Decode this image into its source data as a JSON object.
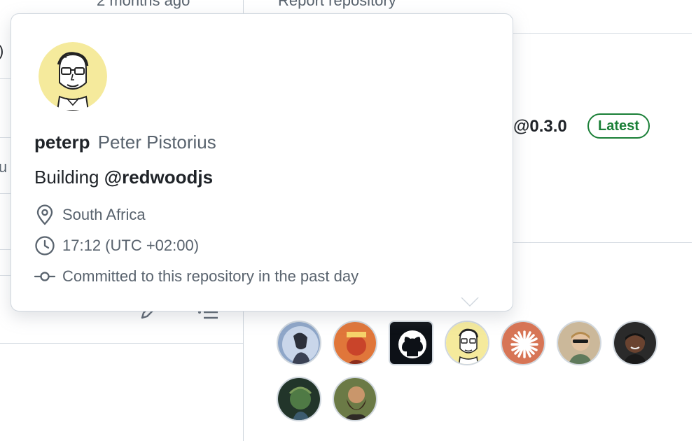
{
  "background": {
    "left_top_text": "2 months ago",
    "left_partial_paren": ")",
    "left_partial_u": "u",
    "right_top_text": "Report repository",
    "release_version": "@0.3.0",
    "latest_badge": "Latest"
  },
  "hovercard": {
    "login": "peterp",
    "full_name": "Peter Pistorius",
    "bio_prefix": "Building ",
    "bio_mention": "@redwoodjs",
    "location": "South Africa",
    "local_time": "17:12 (UTC +02:00)",
    "commit_note": "Committed to this repository in the past day"
  },
  "icons": {
    "location": "location-pin-icon",
    "clock": "clock-icon",
    "commit": "git-commit-icon",
    "edit": "pencil-icon",
    "list": "list-icon"
  },
  "colors": {
    "latest_green": "#1a7f37",
    "muted_text": "#59636e",
    "border": "#d0d7de"
  }
}
